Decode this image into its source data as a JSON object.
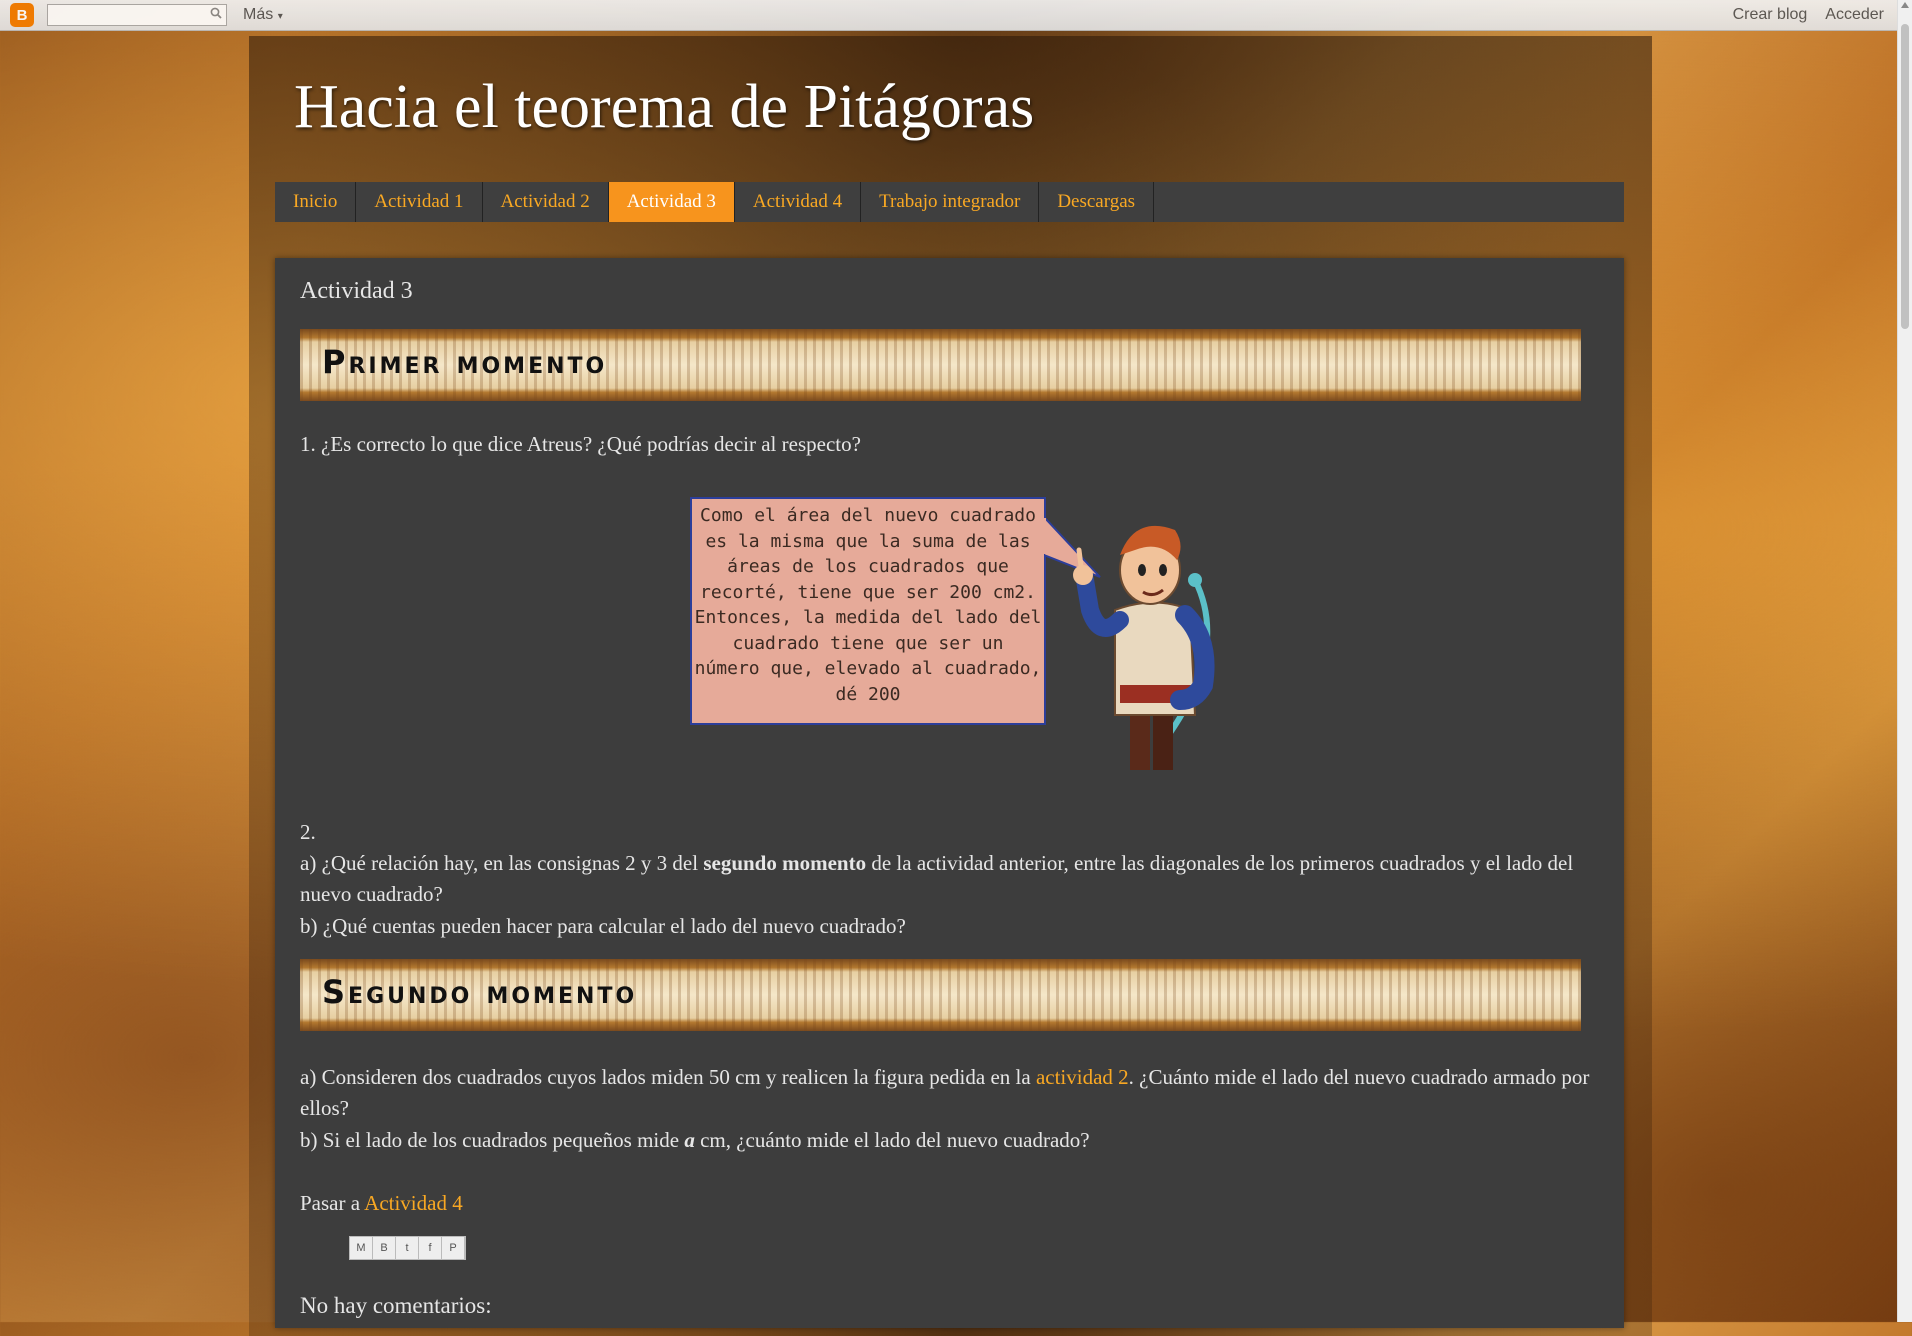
{
  "navbar": {
    "logo_letter": "B",
    "more_label": "Más",
    "create_blog_label": "Crear blog",
    "sign_in_label": "Acceder"
  },
  "blog": {
    "title": "Hacia el teorema de Pitágoras"
  },
  "tabs": [
    {
      "label": "Inicio",
      "active": false
    },
    {
      "label": "Actividad 1",
      "active": false
    },
    {
      "label": "Actividad 2",
      "active": false
    },
    {
      "label": "Actividad 3",
      "active": true
    },
    {
      "label": "Actividad 4",
      "active": false
    },
    {
      "label": "Trabajo integrador",
      "active": false
    },
    {
      "label": "Descargas",
      "active": false
    }
  ],
  "post": {
    "title": "Actividad 3",
    "banner1": "Primer momento",
    "q1": "1. ¿Es correcto lo que dice Atreus? ¿Qué podrías decir al respecto?",
    "speech_lines": [
      "Como el área del nuevo cuadrado",
      "es la misma que la suma de las",
      "áreas de los cuadrados que",
      "recorté, tiene que ser 200 cm2.",
      "Entonces, la medida del lado del",
      "cuadrado tiene que ser un",
      "número que, elevado al cuadrado,",
      "dé 200"
    ],
    "q2_number": "2.",
    "q2a_prefix": "a) ¿Qué relación hay, en las consignas 2 y 3 del ",
    "q2a_bold": "segundo momento",
    "q2a_suffix": " de la actividad anterior, entre las diagonales de los primeros cuadrados y el lado del nuevo cuadrado?",
    "q2b": "b) ¿Qué cuentas pueden hacer para calcular el lado del nuevo cuadrado?",
    "banner2": "Segundo momento",
    "s2a_prefix": "a) Consideren dos cuadrados cuyos lados miden 50 cm y realicen la figura pedida en la ",
    "s2a_link": "actividad 2",
    "s2a_suffix": ". ¿Cuánto mide el lado del nuevo cuadrado armado por ellos?",
    "s2b_prefix": "b) Si el lado de los cuadrados pequeños mide ",
    "s2b_var": "a",
    "s2b_suffix": " cm, ¿cuánto mide el lado del nuevo cuadrado?",
    "next_prefix": "Pasar a ",
    "next_link": "Actividad 4",
    "share_buttons": [
      "M",
      "B",
      "t",
      "f",
      "P"
    ],
    "comments_heading": "No hay comentarios:"
  },
  "colors": {
    "accent": "#f9a823",
    "active_tab": "#f7941d",
    "panel": "#3d3d3d",
    "speech_bg": "#e6aa99",
    "speech_border": "#2c3e9a"
  }
}
